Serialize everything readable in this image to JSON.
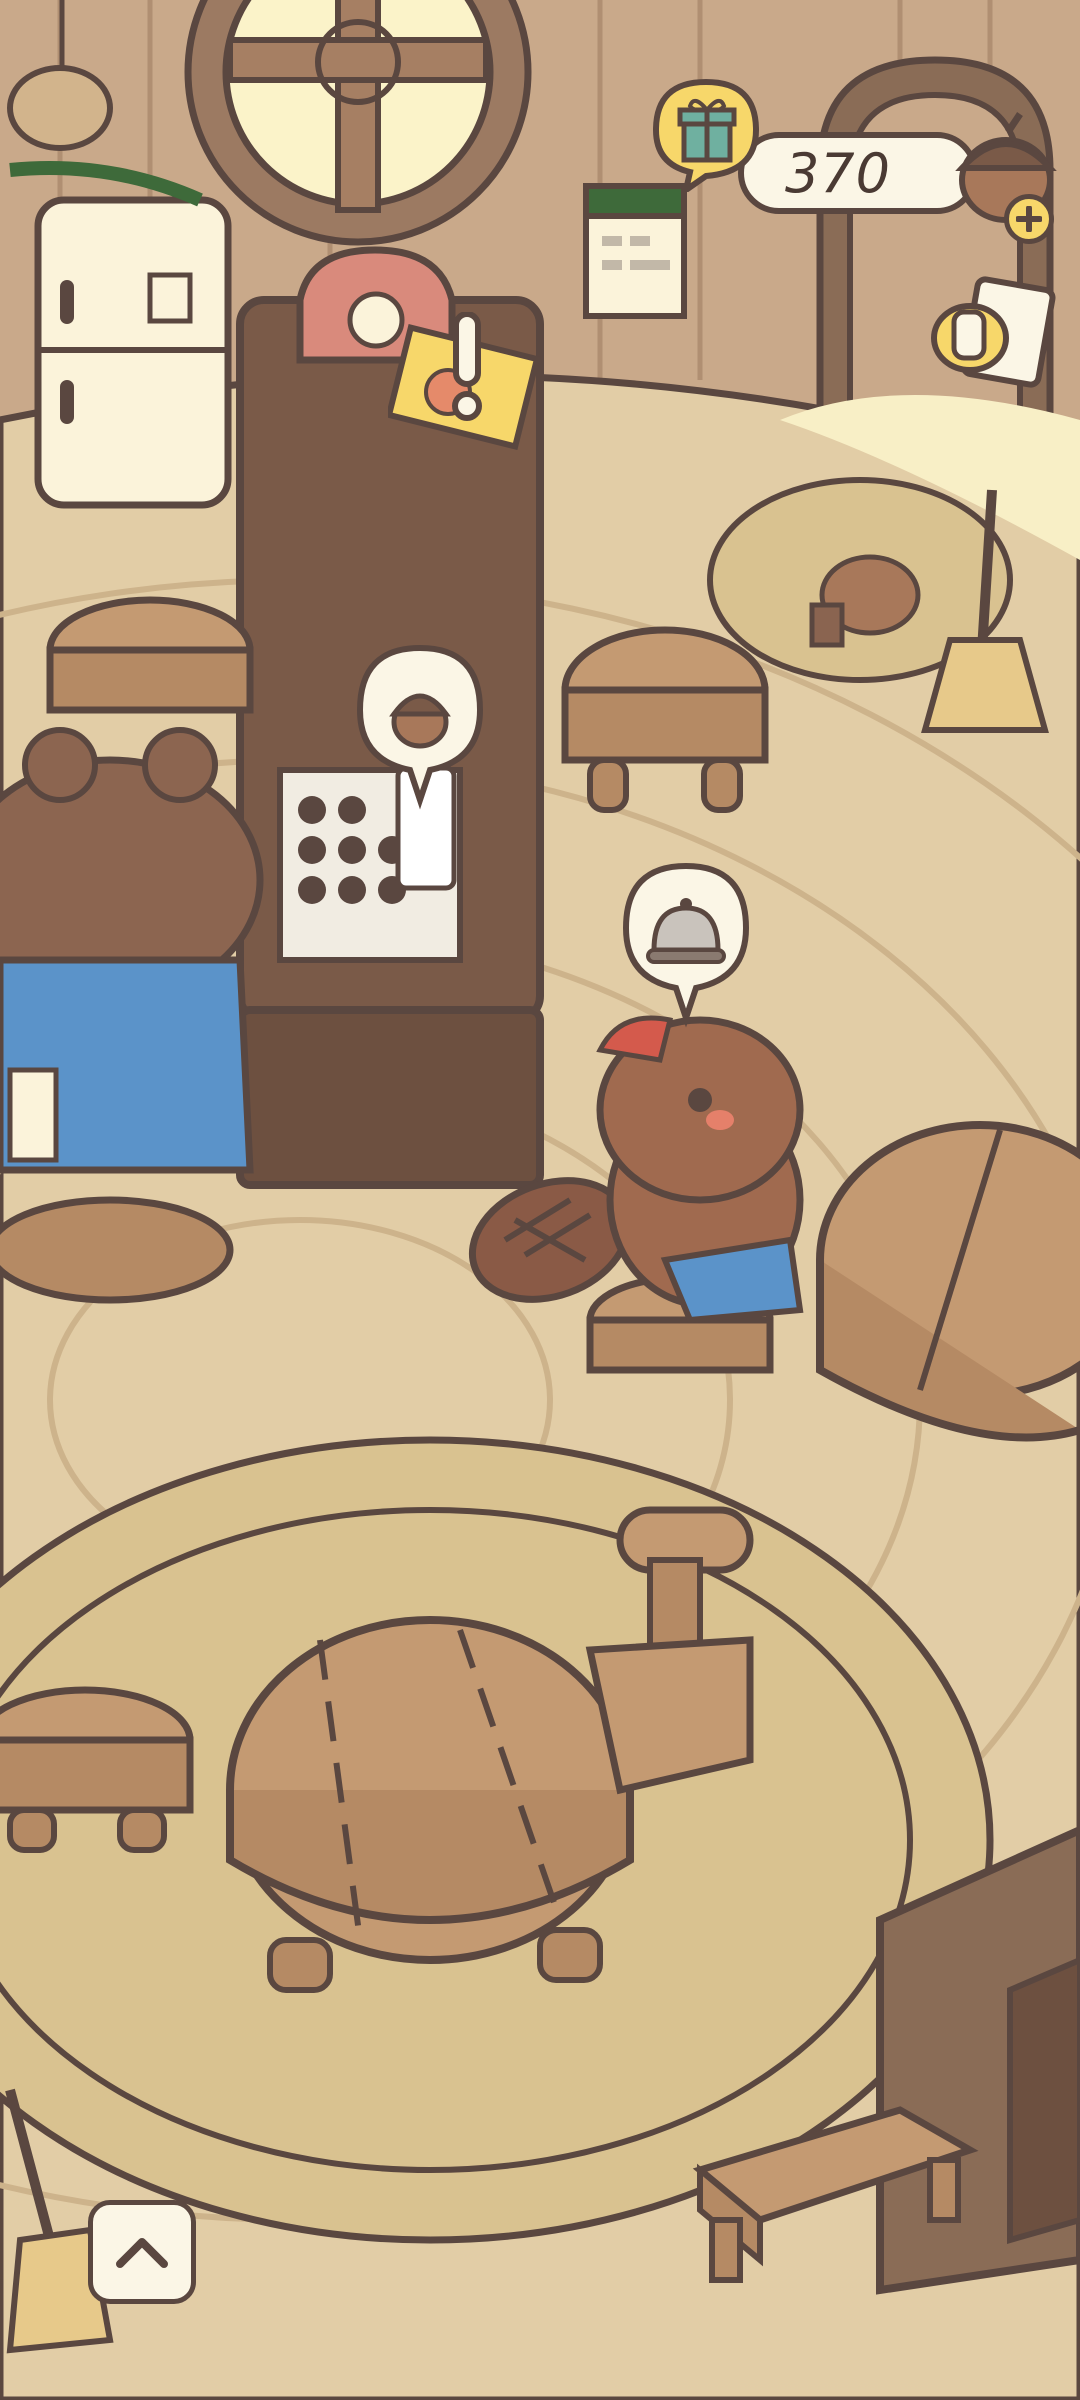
{
  "hud": {
    "acorn_count": "370",
    "icons": {
      "currency": "acorn-icon",
      "add": "plus-icon",
      "gift": "gift-icon",
      "memo": "memo-icon",
      "expand": "chevron-up-icon",
      "alert": "exclamation-icon"
    }
  },
  "scene": {
    "bubbles": [
      {
        "name": "acorn-order-bubble",
        "icon": "acorn-icon"
      },
      {
        "name": "service-bell-bubble",
        "icon": "service-bell-icon"
      }
    ]
  },
  "palette": {
    "floor": "#e2cda6",
    "rug": "#d9c290",
    "wall": "#c9a98a",
    "wood_dark": "#7a5a48",
    "wood_light": "#c49a72",
    "outline": "#5a4740",
    "accent_yellow": "#f7d76a",
    "overalls_blue": "#5b93c9"
  }
}
